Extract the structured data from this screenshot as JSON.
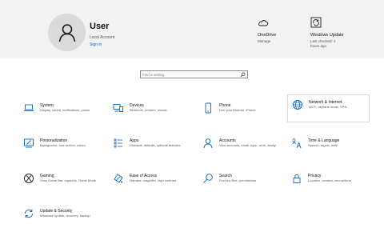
{
  "header": {
    "user_name": "User",
    "account_type": "Local Account",
    "sign_in": "Sign in",
    "onedrive": {
      "title": "OneDrive",
      "subtitle": "Manage"
    },
    "windows_update": {
      "title": "Windows Update",
      "subtitle_line1": "Last checked: 4",
      "subtitle_line2": "hours ago"
    }
  },
  "search": {
    "placeholder": "Find a setting"
  },
  "categories": [
    {
      "title": "System",
      "description": "Display, sound, notifications, power",
      "icon": "laptop-icon"
    },
    {
      "title": "Devices",
      "description": "Bluetooth, printers, mouse",
      "icon": "devices-icon"
    },
    {
      "title": "Phone",
      "description": "Link your Android, iPhone",
      "icon": "phone-icon"
    },
    {
      "title": "Network & Internet",
      "description": "Wi-Fi, airplane mode, VPN",
      "icon": "globe-icon"
    },
    {
      "title": "Personalization",
      "description": "Background, lock screen, colors",
      "icon": "paintbrush-icon"
    },
    {
      "title": "Apps",
      "description": "Uninstall, defaults, optional features",
      "icon": "apps-icon"
    },
    {
      "title": "Accounts",
      "description": "Your accounts, email, sync, work, family",
      "icon": "person-icon"
    },
    {
      "title": "Time & Language",
      "description": "Speech, region, date",
      "icon": "time-language-icon"
    },
    {
      "title": "Gaming",
      "description": "Xbox Game Bar, captures, Game Mode",
      "icon": "xbox-icon"
    },
    {
      "title": "Ease of Access",
      "description": "Narrator, magnifier, high contrast",
      "icon": "ease-of-access-icon"
    },
    {
      "title": "Search",
      "description": "Find my files, permissions",
      "icon": "search-icon"
    },
    {
      "title": "Privacy",
      "description": "Location, camera, microphone",
      "icon": "lock-icon"
    },
    {
      "title": "Update & Security",
      "description": "Windows Update, recovery, backup",
      "icon": "refresh-icon"
    }
  ],
  "colors": {
    "accent": "#0067c0",
    "header_bg": "#f2f2f2"
  }
}
